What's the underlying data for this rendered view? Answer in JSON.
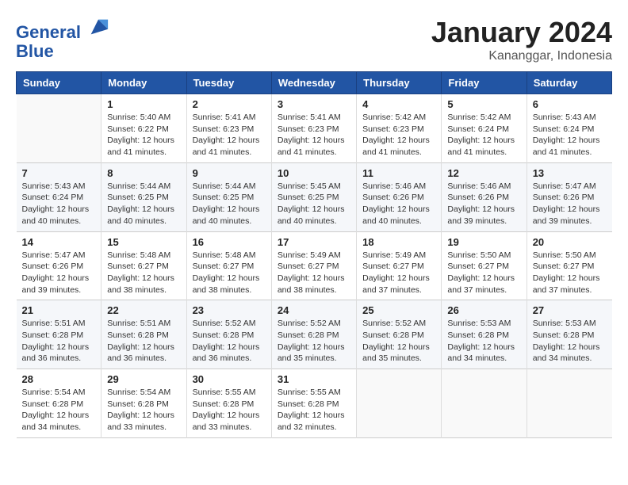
{
  "header": {
    "logo_line1": "General",
    "logo_line2": "Blue",
    "month_year": "January 2024",
    "location": "Kananggar, Indonesia"
  },
  "days_of_week": [
    "Sunday",
    "Monday",
    "Tuesday",
    "Wednesday",
    "Thursday",
    "Friday",
    "Saturday"
  ],
  "weeks": [
    [
      {
        "num": "",
        "info": ""
      },
      {
        "num": "1",
        "info": "Sunrise: 5:40 AM\nSunset: 6:22 PM\nDaylight: 12 hours\nand 41 minutes."
      },
      {
        "num": "2",
        "info": "Sunrise: 5:41 AM\nSunset: 6:23 PM\nDaylight: 12 hours\nand 41 minutes."
      },
      {
        "num": "3",
        "info": "Sunrise: 5:41 AM\nSunset: 6:23 PM\nDaylight: 12 hours\nand 41 minutes."
      },
      {
        "num": "4",
        "info": "Sunrise: 5:42 AM\nSunset: 6:23 PM\nDaylight: 12 hours\nand 41 minutes."
      },
      {
        "num": "5",
        "info": "Sunrise: 5:42 AM\nSunset: 6:24 PM\nDaylight: 12 hours\nand 41 minutes."
      },
      {
        "num": "6",
        "info": "Sunrise: 5:43 AM\nSunset: 6:24 PM\nDaylight: 12 hours\nand 41 minutes."
      }
    ],
    [
      {
        "num": "7",
        "info": "Sunrise: 5:43 AM\nSunset: 6:24 PM\nDaylight: 12 hours\nand 40 minutes."
      },
      {
        "num": "8",
        "info": "Sunrise: 5:44 AM\nSunset: 6:25 PM\nDaylight: 12 hours\nand 40 minutes."
      },
      {
        "num": "9",
        "info": "Sunrise: 5:44 AM\nSunset: 6:25 PM\nDaylight: 12 hours\nand 40 minutes."
      },
      {
        "num": "10",
        "info": "Sunrise: 5:45 AM\nSunset: 6:25 PM\nDaylight: 12 hours\nand 40 minutes."
      },
      {
        "num": "11",
        "info": "Sunrise: 5:46 AM\nSunset: 6:26 PM\nDaylight: 12 hours\nand 40 minutes."
      },
      {
        "num": "12",
        "info": "Sunrise: 5:46 AM\nSunset: 6:26 PM\nDaylight: 12 hours\nand 39 minutes."
      },
      {
        "num": "13",
        "info": "Sunrise: 5:47 AM\nSunset: 6:26 PM\nDaylight: 12 hours\nand 39 minutes."
      }
    ],
    [
      {
        "num": "14",
        "info": "Sunrise: 5:47 AM\nSunset: 6:26 PM\nDaylight: 12 hours\nand 39 minutes."
      },
      {
        "num": "15",
        "info": "Sunrise: 5:48 AM\nSunset: 6:27 PM\nDaylight: 12 hours\nand 38 minutes."
      },
      {
        "num": "16",
        "info": "Sunrise: 5:48 AM\nSunset: 6:27 PM\nDaylight: 12 hours\nand 38 minutes."
      },
      {
        "num": "17",
        "info": "Sunrise: 5:49 AM\nSunset: 6:27 PM\nDaylight: 12 hours\nand 38 minutes."
      },
      {
        "num": "18",
        "info": "Sunrise: 5:49 AM\nSunset: 6:27 PM\nDaylight: 12 hours\nand 37 minutes."
      },
      {
        "num": "19",
        "info": "Sunrise: 5:50 AM\nSunset: 6:27 PM\nDaylight: 12 hours\nand 37 minutes."
      },
      {
        "num": "20",
        "info": "Sunrise: 5:50 AM\nSunset: 6:27 PM\nDaylight: 12 hours\nand 37 minutes."
      }
    ],
    [
      {
        "num": "21",
        "info": "Sunrise: 5:51 AM\nSunset: 6:28 PM\nDaylight: 12 hours\nand 36 minutes."
      },
      {
        "num": "22",
        "info": "Sunrise: 5:51 AM\nSunset: 6:28 PM\nDaylight: 12 hours\nand 36 minutes."
      },
      {
        "num": "23",
        "info": "Sunrise: 5:52 AM\nSunset: 6:28 PM\nDaylight: 12 hours\nand 36 minutes."
      },
      {
        "num": "24",
        "info": "Sunrise: 5:52 AM\nSunset: 6:28 PM\nDaylight: 12 hours\nand 35 minutes."
      },
      {
        "num": "25",
        "info": "Sunrise: 5:52 AM\nSunset: 6:28 PM\nDaylight: 12 hours\nand 35 minutes."
      },
      {
        "num": "26",
        "info": "Sunrise: 5:53 AM\nSunset: 6:28 PM\nDaylight: 12 hours\nand 34 minutes."
      },
      {
        "num": "27",
        "info": "Sunrise: 5:53 AM\nSunset: 6:28 PM\nDaylight: 12 hours\nand 34 minutes."
      }
    ],
    [
      {
        "num": "28",
        "info": "Sunrise: 5:54 AM\nSunset: 6:28 PM\nDaylight: 12 hours\nand 34 minutes."
      },
      {
        "num": "29",
        "info": "Sunrise: 5:54 AM\nSunset: 6:28 PM\nDaylight: 12 hours\nand 33 minutes."
      },
      {
        "num": "30",
        "info": "Sunrise: 5:55 AM\nSunset: 6:28 PM\nDaylight: 12 hours\nand 33 minutes."
      },
      {
        "num": "31",
        "info": "Sunrise: 5:55 AM\nSunset: 6:28 PM\nDaylight: 12 hours\nand 32 minutes."
      },
      {
        "num": "",
        "info": ""
      },
      {
        "num": "",
        "info": ""
      },
      {
        "num": "",
        "info": ""
      }
    ]
  ]
}
